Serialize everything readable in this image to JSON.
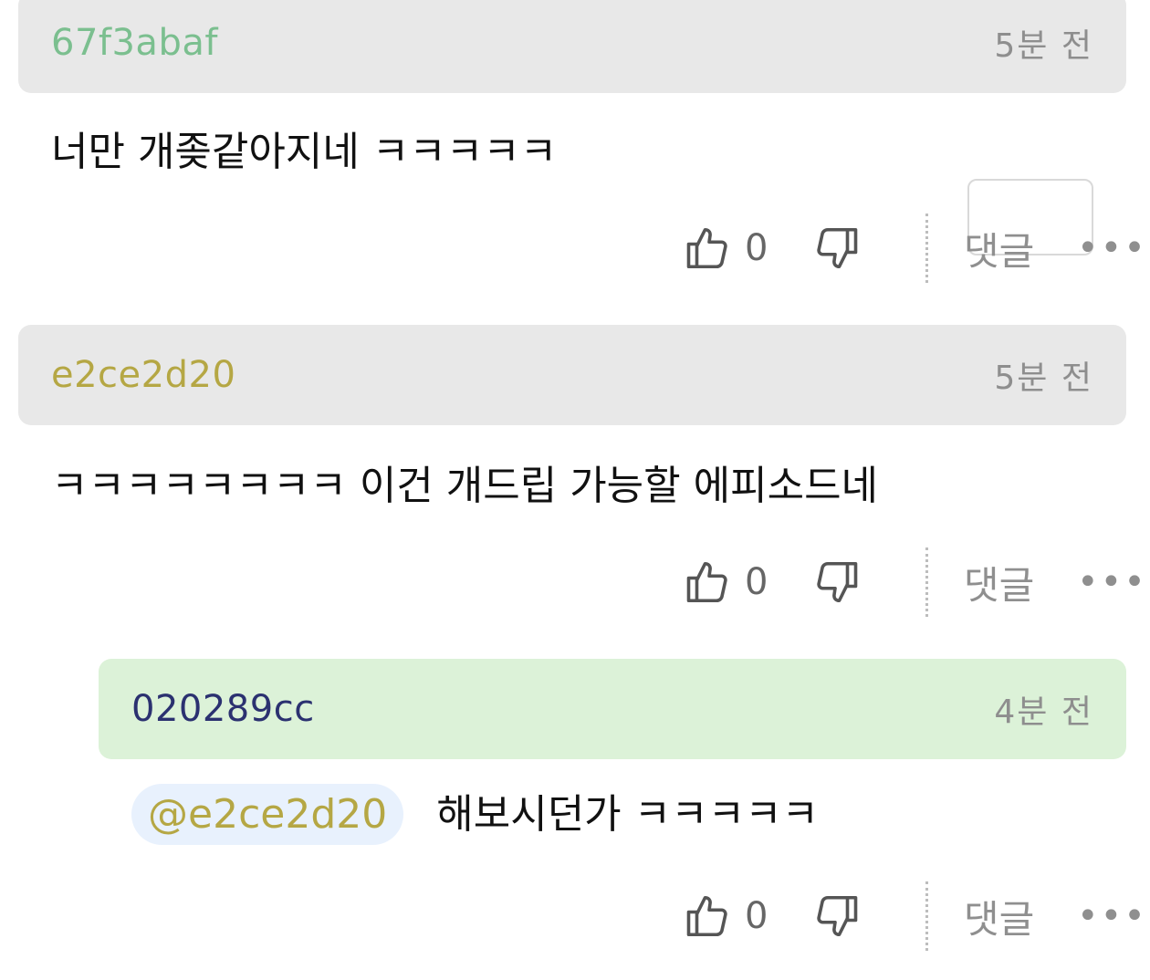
{
  "comments": [
    {
      "author": "67f3abaf",
      "author_color": "#7bbf8f",
      "time": "5분 전",
      "text": "너만 개좆같아지네 ㅋㅋㅋㅋㅋ",
      "likes": "0",
      "reply_label": "댓글",
      "more_label": "•••"
    },
    {
      "author": "e2ce2d20",
      "author_color": "#b5a744",
      "time": "5분 전",
      "text": "ㅋㅋㅋㅋㅋㅋㅋㅋ 이건 개드립 가능할 에피소드네",
      "likes": "0",
      "reply_label": "댓글",
      "more_label": "•••"
    },
    {
      "author": "020289cc",
      "author_color": "#2b3170",
      "time": "4분 전",
      "mention": "@e2ce2d20",
      "text": "해보시던가 ㅋㅋㅋㅋㅋ",
      "likes": "0",
      "reply_label": "댓글",
      "more_label": "•••"
    }
  ],
  "icons": {
    "like": "thumbs-up-icon",
    "dislike": "thumbs-down-icon",
    "more": "more-dots-icon"
  }
}
